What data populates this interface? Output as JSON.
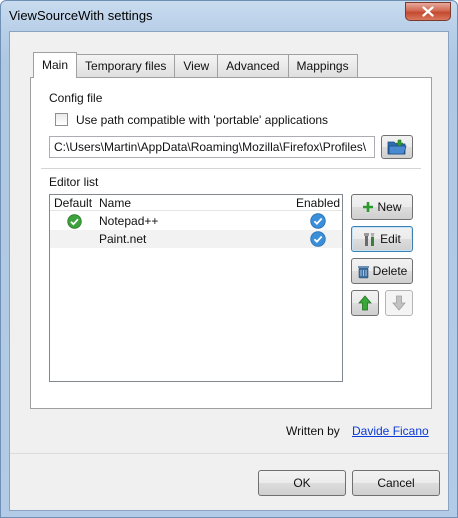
{
  "window": {
    "title": "ViewSourceWith settings"
  },
  "tabs": [
    {
      "label": "Main",
      "active": true
    },
    {
      "label": "Temporary files",
      "active": false
    },
    {
      "label": "View",
      "active": false
    },
    {
      "label": "Advanced",
      "active": false
    },
    {
      "label": "Mappings",
      "active": false
    }
  ],
  "config": {
    "group_label": "Config file",
    "portable_label": "Use path compatible with 'portable' applications",
    "portable_checked": false,
    "path_value": "C:\\Users\\Martin\\AppData\\Roaming\\Mozilla\\Firefox\\Profiles\\"
  },
  "editors": {
    "group_label": "Editor list",
    "columns": {
      "default": "Default",
      "name": "Name",
      "enabled": "Enabled"
    },
    "rows": [
      {
        "name": "Notepad++",
        "is_default": true,
        "enabled": true
      },
      {
        "name": "Paint.net",
        "is_default": false,
        "enabled": true
      }
    ],
    "buttons": {
      "new": "New",
      "edit": "Edit",
      "delete": "Delete"
    }
  },
  "footer": {
    "written_by": "Written by",
    "author": "Davide Ficano",
    "ok": "OK",
    "cancel": "Cancel"
  },
  "colors": {
    "link": "#0b3bd6",
    "titlebar": "#b8cfe8",
    "close": "#c44a2f"
  }
}
